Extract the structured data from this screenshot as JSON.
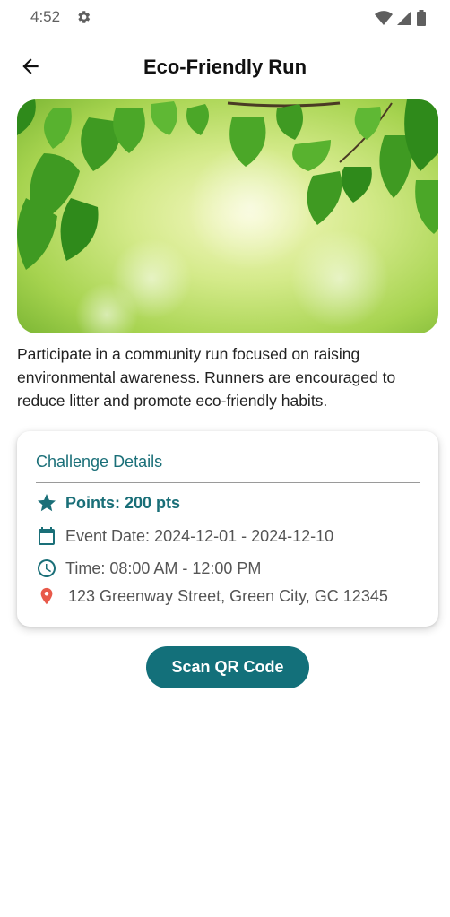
{
  "status_bar": {
    "time": "4:52"
  },
  "app_bar": {
    "title": "Eco-Friendly Run"
  },
  "description": "Participate in a community run focused on raising environmental awareness. Runners are encouraged to reduce litter and promote eco-friendly habits.",
  "challenge": {
    "title": "Challenge Details",
    "points": "Points: 200 pts",
    "event_date": "Event Date: 2024-12-01 - 2024-12-10",
    "time": "Time: 08:00 AM - 12:00 PM",
    "location": "123 Greenway Street, Green City, GC 12345"
  },
  "actions": {
    "scan_label": "Scan QR Code"
  },
  "colors": {
    "accent": "#13707a",
    "text_accent": "#1a6f78",
    "location_pin": "#e8594a"
  },
  "icons": {
    "status": [
      "gear-icon",
      "wifi-icon",
      "signal-icon",
      "battery-icon"
    ],
    "back": "arrow-left-icon",
    "points": "star-icon",
    "date": "calendar-icon",
    "time": "clock-icon",
    "location": "location-pin-icon"
  }
}
